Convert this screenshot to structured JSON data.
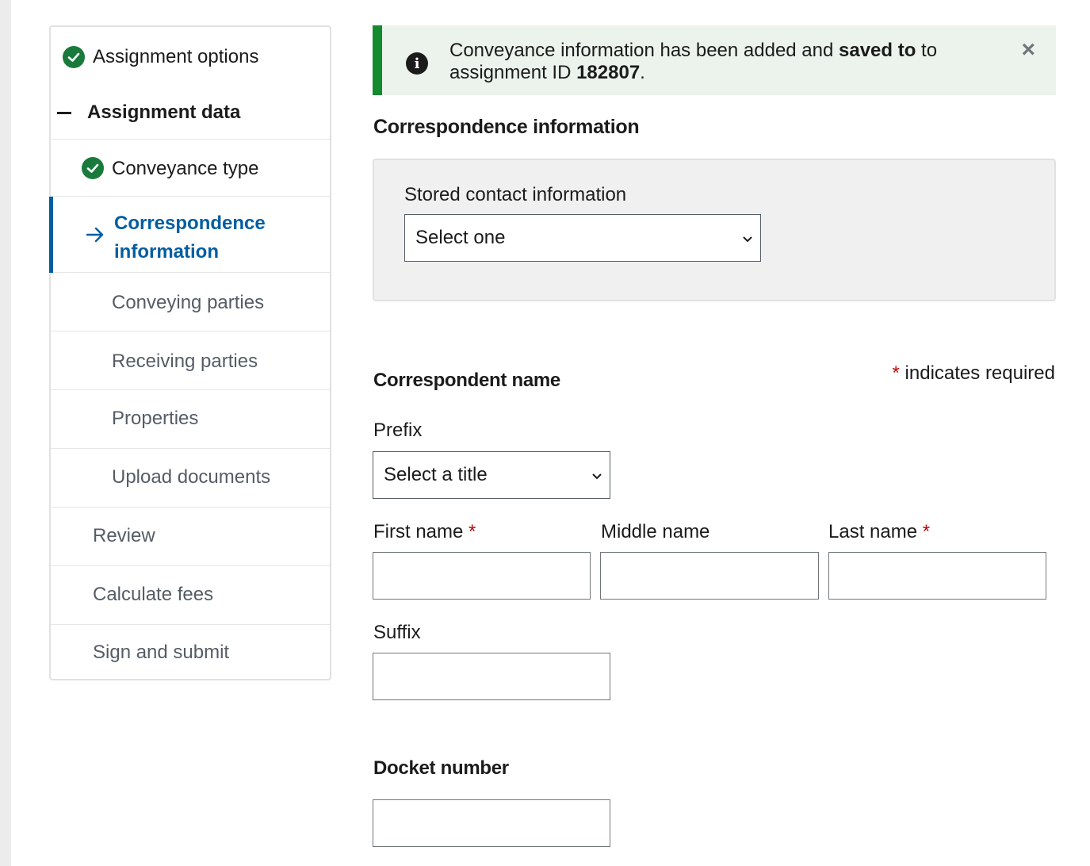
{
  "nav": {
    "assignment_options": "Assignment options",
    "assignment_data": "Assignment data",
    "conveyance_type": "Conveyance type",
    "correspondence_line1": "Correspondence",
    "correspondence_line2": "information",
    "conveying_parties": "Conveying parties",
    "receiving_parties": "Receiving parties",
    "properties": "Properties",
    "upload_documents": "Upload documents",
    "review": "Review",
    "calculate_fees": "Calculate fees",
    "sign_and_submit": "Sign and submit"
  },
  "alert": {
    "text_part1": "Conveyance information has been added and ",
    "text_bold1": "saved to",
    "text_part2": " to assignment ID ",
    "assignment_id": "182807",
    "text_end": ".",
    "close_glyph": "×"
  },
  "main": {
    "section_title": "Correspondence information",
    "stored_contact_label": "Stored contact information",
    "stored_contact_value": "Select one",
    "correspondent_name_title": "Correspondent name",
    "required_asterisk": "*",
    "required_text": "indicates required",
    "prefix_label": "Prefix",
    "prefix_value": "Select a title",
    "first_name_label": "First name",
    "middle_name_label": "Middle name",
    "last_name_label": "Last name",
    "suffix_label": "Suffix",
    "docket_number_title": "Docket number",
    "asterisk": "*"
  },
  "icons": [
    "check-circle-icon",
    "minus-icon",
    "arrow-right-icon",
    "info-icon",
    "close-icon",
    "chevron-down-icon"
  ],
  "colors": {
    "accent": "#005ea2",
    "success": "#138a2e",
    "required": "#b50909"
  }
}
